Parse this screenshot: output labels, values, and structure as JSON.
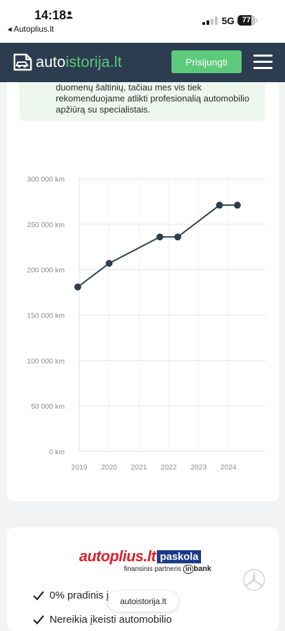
{
  "status_bar": {
    "time": "14:18",
    "back_label": "◂ Autoplius.lt",
    "network": "5G",
    "battery_level": "77",
    "battery_fraction": 0.77
  },
  "header": {
    "logo_text_main": "auto",
    "logo_text_accent": "istorija.lt",
    "login_label": "Prisijungti",
    "brand_color": "#2b3d4f",
    "accent_color": "#5dc97b"
  },
  "notice": {
    "text": "duomenų šaltinių, tačiau mes vis tiek rekomenduojame atlikti profesionalią automobilio apžiūrą su specialistais."
  },
  "chart_data": {
    "type": "line",
    "x_tick_labels": [
      "2019",
      "2020",
      "2021",
      "2022",
      "2023",
      "2024"
    ],
    "y_tick_labels": [
      "0 km",
      "50 000 km",
      "100 000 km",
      "150 000 km",
      "200 000 km",
      "250 000 km",
      "300 000 km"
    ],
    "ylim": [
      0,
      300000
    ],
    "xlim": [
      2018.95,
      2025.25
    ],
    "series": [
      {
        "x": [
          2018.95,
          2020.0,
          2021.7,
          2022.3,
          2023.7,
          2024.3
        ],
        "y": [
          181000,
          207000,
          236000,
          236000,
          271000,
          271000
        ]
      }
    ],
    "grid": true
  },
  "promo": {
    "brand_main": "autoplius.lt",
    "brand_tag": "paskola",
    "partner_text": "finansinis partneris",
    "partner_brand": "bank",
    "partner_in": "in",
    "features": [
      "0% pradinis į",
      "Nereikia įkeisti automobilio"
    ]
  },
  "toast": {
    "text": "autoistorija.lt"
  }
}
